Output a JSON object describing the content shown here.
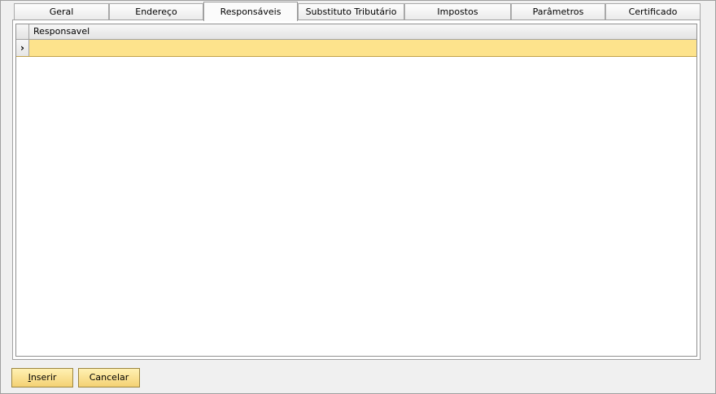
{
  "tabs": [
    {
      "label": "Geral"
    },
    {
      "label": "Endereço"
    },
    {
      "label": "Responsáveis"
    },
    {
      "label": "Substituto Tributário"
    },
    {
      "label": "Impostos"
    },
    {
      "label": "Parâmetros"
    },
    {
      "label": "Certificado"
    }
  ],
  "active_tab": "Responsáveis",
  "grid": {
    "columns": [
      "Responsavel"
    ],
    "rows": [
      {
        "Responsavel": "",
        "selected": true
      }
    ],
    "row_indicator": "›"
  },
  "buttons": {
    "insert_mnemonic": "I",
    "insert_rest": "nserir",
    "cancel_label": "Cancelar"
  },
  "colors": {
    "selected_row": "#fde38c",
    "button": "#f8dc86"
  }
}
